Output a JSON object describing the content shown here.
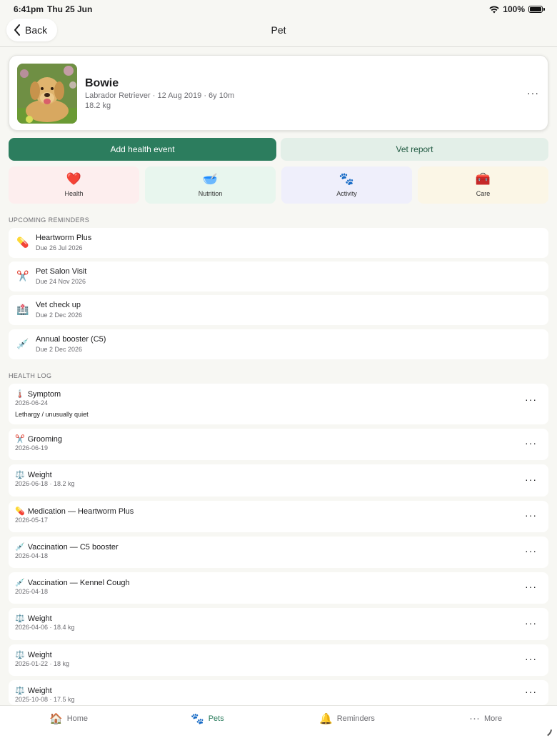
{
  "status_bar": {
    "time": "6:41pm",
    "date": "Thu 25 Jun",
    "battery": "100%",
    "icons": [
      "wifi-icon",
      "battery-icon"
    ]
  },
  "nav": {
    "back_label": "Back",
    "title": "Pet"
  },
  "pet": {
    "name": "Bowie",
    "meta": "Labrador Retriever · 12 Aug 2019 · 6y 10m",
    "weight": "18.2 kg",
    "more": "···"
  },
  "actions": {
    "add_health_event": "Add health event",
    "vet_report": "Vet report"
  },
  "categories": [
    {
      "label": "Health",
      "icon": "❤️",
      "color": "#fdeeee"
    },
    {
      "label": "Nutrition",
      "icon": "🥣",
      "color": "#e8f6ee"
    },
    {
      "label": "Activity",
      "icon": "🐾",
      "color": "#efeffb"
    },
    {
      "label": "Care",
      "icon": "🧰",
      "color": "#fbf6e6"
    }
  ],
  "reminders_title": "UPCOMING REMINDERS",
  "reminders": [
    {
      "icon": "💊",
      "title": "Heartworm Plus",
      "due": "Due 26 Jul 2026"
    },
    {
      "icon": "✂️",
      "title": "Pet Salon Visit",
      "due": "Due 24 Nov 2026"
    },
    {
      "icon": "🏥",
      "title": "Vet check up",
      "due": "Due 2 Dec 2026"
    },
    {
      "icon": "💉",
      "title": "Annual booster (C5)",
      "due": "Due 2 Dec 2026"
    }
  ],
  "health_log_title": "HEALTH LOG",
  "health_log": [
    {
      "icon": "🌡️",
      "title": "Symptom",
      "sub": "2026-06-24",
      "note": "Lethargy / unusually quiet"
    },
    {
      "icon": "✂️",
      "title": "Grooming",
      "sub": "2026-06-19"
    },
    {
      "icon": "⚖️",
      "title": "Weight",
      "sub": "2026-06-18 · 18.2 kg"
    },
    {
      "icon": "💊",
      "title": "Medication — Heartworm Plus",
      "sub": "2026-05-17"
    },
    {
      "icon": "💉",
      "title": "Vaccination — C5 booster",
      "sub": "2026-04-18"
    },
    {
      "icon": "💉",
      "title": "Vaccination — Kennel Cough",
      "sub": "2026-04-18"
    },
    {
      "icon": "⚖️",
      "title": "Weight",
      "sub": "2026-04-06 · 18.4 kg"
    },
    {
      "icon": "⚖️",
      "title": "Weight",
      "sub": "2026-01-22 · 18 kg"
    },
    {
      "icon": "⚖️",
      "title": "Weight",
      "sub": "2025-10-08 · 17.5 kg"
    }
  ],
  "log_more": "···",
  "tabs": [
    {
      "label": "Home",
      "icon": "🏠",
      "active": false
    },
    {
      "label": "Pets",
      "icon": "🐾",
      "active": true
    },
    {
      "label": "Reminders",
      "icon": "🔔",
      "active": false
    },
    {
      "label": "More",
      "icon": "···",
      "active": false
    }
  ]
}
